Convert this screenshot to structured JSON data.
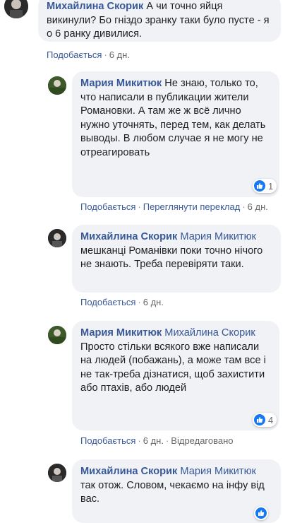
{
  "comments": [
    {
      "author": "Михайлина Скорик",
      "mention": "",
      "text": "А чи точно яйця викинули? Бо гніздо зранку таки було пусте - я о 6 ранку дивилися.",
      "actions": {
        "like": "Подобається",
        "time": "6 дн."
      }
    },
    {
      "author": "Мария Микитюк",
      "mention": "",
      "text": "Не знаю, только то, что написали в публикации жители Романовки. А там же ж всё лично нужно уточнять, перед тем, как делать выводы. В любом случае я не могу не отреагировать",
      "reactions": "1",
      "actions": {
        "like": "Подобається",
        "translate": "Переглянути переклад",
        "time": "6 дн."
      }
    },
    {
      "author": "Михайлина Скорик",
      "mention": "Мария Микитюк",
      "text": "мешканці Романівки поки точно нічого не знають. Треба перевіряти таки.",
      "actions": {
        "like": "Подобається",
        "time": "6 дн."
      }
    },
    {
      "author": "Мария Микитюк",
      "mention": "Михайлина Скорик",
      "text": "Просто стільки всякого вже написали на людей (побажань), а може там все і не так-треба дізнатися, щоб захистити або птахів, або людей",
      "reactions": "4",
      "actions": {
        "like": "Подобається",
        "time": "6 дн.",
        "edited": "Відредаговано"
      }
    },
    {
      "author": "Михайлина Скорик",
      "mention": "Мария Микитюк",
      "text": "так отож. Словом, чекаємо на інфу від вас."
    }
  ],
  "colors": {
    "link": "#385898",
    "bubble": "#f0f2f5",
    "like": "#1877f2"
  }
}
